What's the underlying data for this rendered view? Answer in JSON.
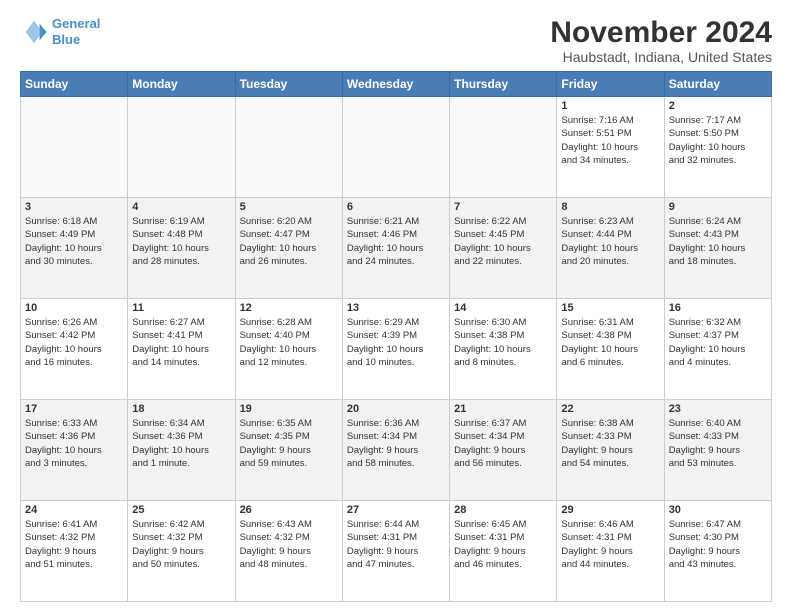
{
  "header": {
    "logo_line1": "General",
    "logo_line2": "Blue",
    "title": "November 2024",
    "subtitle": "Haubstadt, Indiana, United States"
  },
  "days_of_week": [
    "Sunday",
    "Monday",
    "Tuesday",
    "Wednesday",
    "Thursday",
    "Friday",
    "Saturday"
  ],
  "weeks": [
    {
      "alt": false,
      "days": [
        {
          "num": "",
          "info": "",
          "empty": true
        },
        {
          "num": "",
          "info": "",
          "empty": true
        },
        {
          "num": "",
          "info": "",
          "empty": true
        },
        {
          "num": "",
          "info": "",
          "empty": true
        },
        {
          "num": "",
          "info": "",
          "empty": true
        },
        {
          "num": "1",
          "info": "Sunrise: 7:16 AM\nSunset: 5:51 PM\nDaylight: 10 hours\nand 34 minutes.",
          "empty": false
        },
        {
          "num": "2",
          "info": "Sunrise: 7:17 AM\nSunset: 5:50 PM\nDaylight: 10 hours\nand 32 minutes.",
          "empty": false
        }
      ]
    },
    {
      "alt": true,
      "days": [
        {
          "num": "3",
          "info": "Sunrise: 6:18 AM\nSunset: 4:49 PM\nDaylight: 10 hours\nand 30 minutes.",
          "empty": false
        },
        {
          "num": "4",
          "info": "Sunrise: 6:19 AM\nSunset: 4:48 PM\nDaylight: 10 hours\nand 28 minutes.",
          "empty": false
        },
        {
          "num": "5",
          "info": "Sunrise: 6:20 AM\nSunset: 4:47 PM\nDaylight: 10 hours\nand 26 minutes.",
          "empty": false
        },
        {
          "num": "6",
          "info": "Sunrise: 6:21 AM\nSunset: 4:46 PM\nDaylight: 10 hours\nand 24 minutes.",
          "empty": false
        },
        {
          "num": "7",
          "info": "Sunrise: 6:22 AM\nSunset: 4:45 PM\nDaylight: 10 hours\nand 22 minutes.",
          "empty": false
        },
        {
          "num": "8",
          "info": "Sunrise: 6:23 AM\nSunset: 4:44 PM\nDaylight: 10 hours\nand 20 minutes.",
          "empty": false
        },
        {
          "num": "9",
          "info": "Sunrise: 6:24 AM\nSunset: 4:43 PM\nDaylight: 10 hours\nand 18 minutes.",
          "empty": false
        }
      ]
    },
    {
      "alt": false,
      "days": [
        {
          "num": "10",
          "info": "Sunrise: 6:26 AM\nSunset: 4:42 PM\nDaylight: 10 hours\nand 16 minutes.",
          "empty": false
        },
        {
          "num": "11",
          "info": "Sunrise: 6:27 AM\nSunset: 4:41 PM\nDaylight: 10 hours\nand 14 minutes.",
          "empty": false
        },
        {
          "num": "12",
          "info": "Sunrise: 6:28 AM\nSunset: 4:40 PM\nDaylight: 10 hours\nand 12 minutes.",
          "empty": false
        },
        {
          "num": "13",
          "info": "Sunrise: 6:29 AM\nSunset: 4:39 PM\nDaylight: 10 hours\nand 10 minutes.",
          "empty": false
        },
        {
          "num": "14",
          "info": "Sunrise: 6:30 AM\nSunset: 4:38 PM\nDaylight: 10 hours\nand 8 minutes.",
          "empty": false
        },
        {
          "num": "15",
          "info": "Sunrise: 6:31 AM\nSunset: 4:38 PM\nDaylight: 10 hours\nand 6 minutes.",
          "empty": false
        },
        {
          "num": "16",
          "info": "Sunrise: 6:32 AM\nSunset: 4:37 PM\nDaylight: 10 hours\nand 4 minutes.",
          "empty": false
        }
      ]
    },
    {
      "alt": true,
      "days": [
        {
          "num": "17",
          "info": "Sunrise: 6:33 AM\nSunset: 4:36 PM\nDaylight: 10 hours\nand 3 minutes.",
          "empty": false
        },
        {
          "num": "18",
          "info": "Sunrise: 6:34 AM\nSunset: 4:36 PM\nDaylight: 10 hours\nand 1 minute.",
          "empty": false
        },
        {
          "num": "19",
          "info": "Sunrise: 6:35 AM\nSunset: 4:35 PM\nDaylight: 9 hours\nand 59 minutes.",
          "empty": false
        },
        {
          "num": "20",
          "info": "Sunrise: 6:36 AM\nSunset: 4:34 PM\nDaylight: 9 hours\nand 58 minutes.",
          "empty": false
        },
        {
          "num": "21",
          "info": "Sunrise: 6:37 AM\nSunset: 4:34 PM\nDaylight: 9 hours\nand 56 minutes.",
          "empty": false
        },
        {
          "num": "22",
          "info": "Sunrise: 6:38 AM\nSunset: 4:33 PM\nDaylight: 9 hours\nand 54 minutes.",
          "empty": false
        },
        {
          "num": "23",
          "info": "Sunrise: 6:40 AM\nSunset: 4:33 PM\nDaylight: 9 hours\nand 53 minutes.",
          "empty": false
        }
      ]
    },
    {
      "alt": false,
      "days": [
        {
          "num": "24",
          "info": "Sunrise: 6:41 AM\nSunset: 4:32 PM\nDaylight: 9 hours\nand 51 minutes.",
          "empty": false
        },
        {
          "num": "25",
          "info": "Sunrise: 6:42 AM\nSunset: 4:32 PM\nDaylight: 9 hours\nand 50 minutes.",
          "empty": false
        },
        {
          "num": "26",
          "info": "Sunrise: 6:43 AM\nSunset: 4:32 PM\nDaylight: 9 hours\nand 48 minutes.",
          "empty": false
        },
        {
          "num": "27",
          "info": "Sunrise: 6:44 AM\nSunset: 4:31 PM\nDaylight: 9 hours\nand 47 minutes.",
          "empty": false
        },
        {
          "num": "28",
          "info": "Sunrise: 6:45 AM\nSunset: 4:31 PM\nDaylight: 9 hours\nand 46 minutes.",
          "empty": false
        },
        {
          "num": "29",
          "info": "Sunrise: 6:46 AM\nSunset: 4:31 PM\nDaylight: 9 hours\nand 44 minutes.",
          "empty": false
        },
        {
          "num": "30",
          "info": "Sunrise: 6:47 AM\nSunset: 4:30 PM\nDaylight: 9 hours\nand 43 minutes.",
          "empty": false
        }
      ]
    }
  ]
}
